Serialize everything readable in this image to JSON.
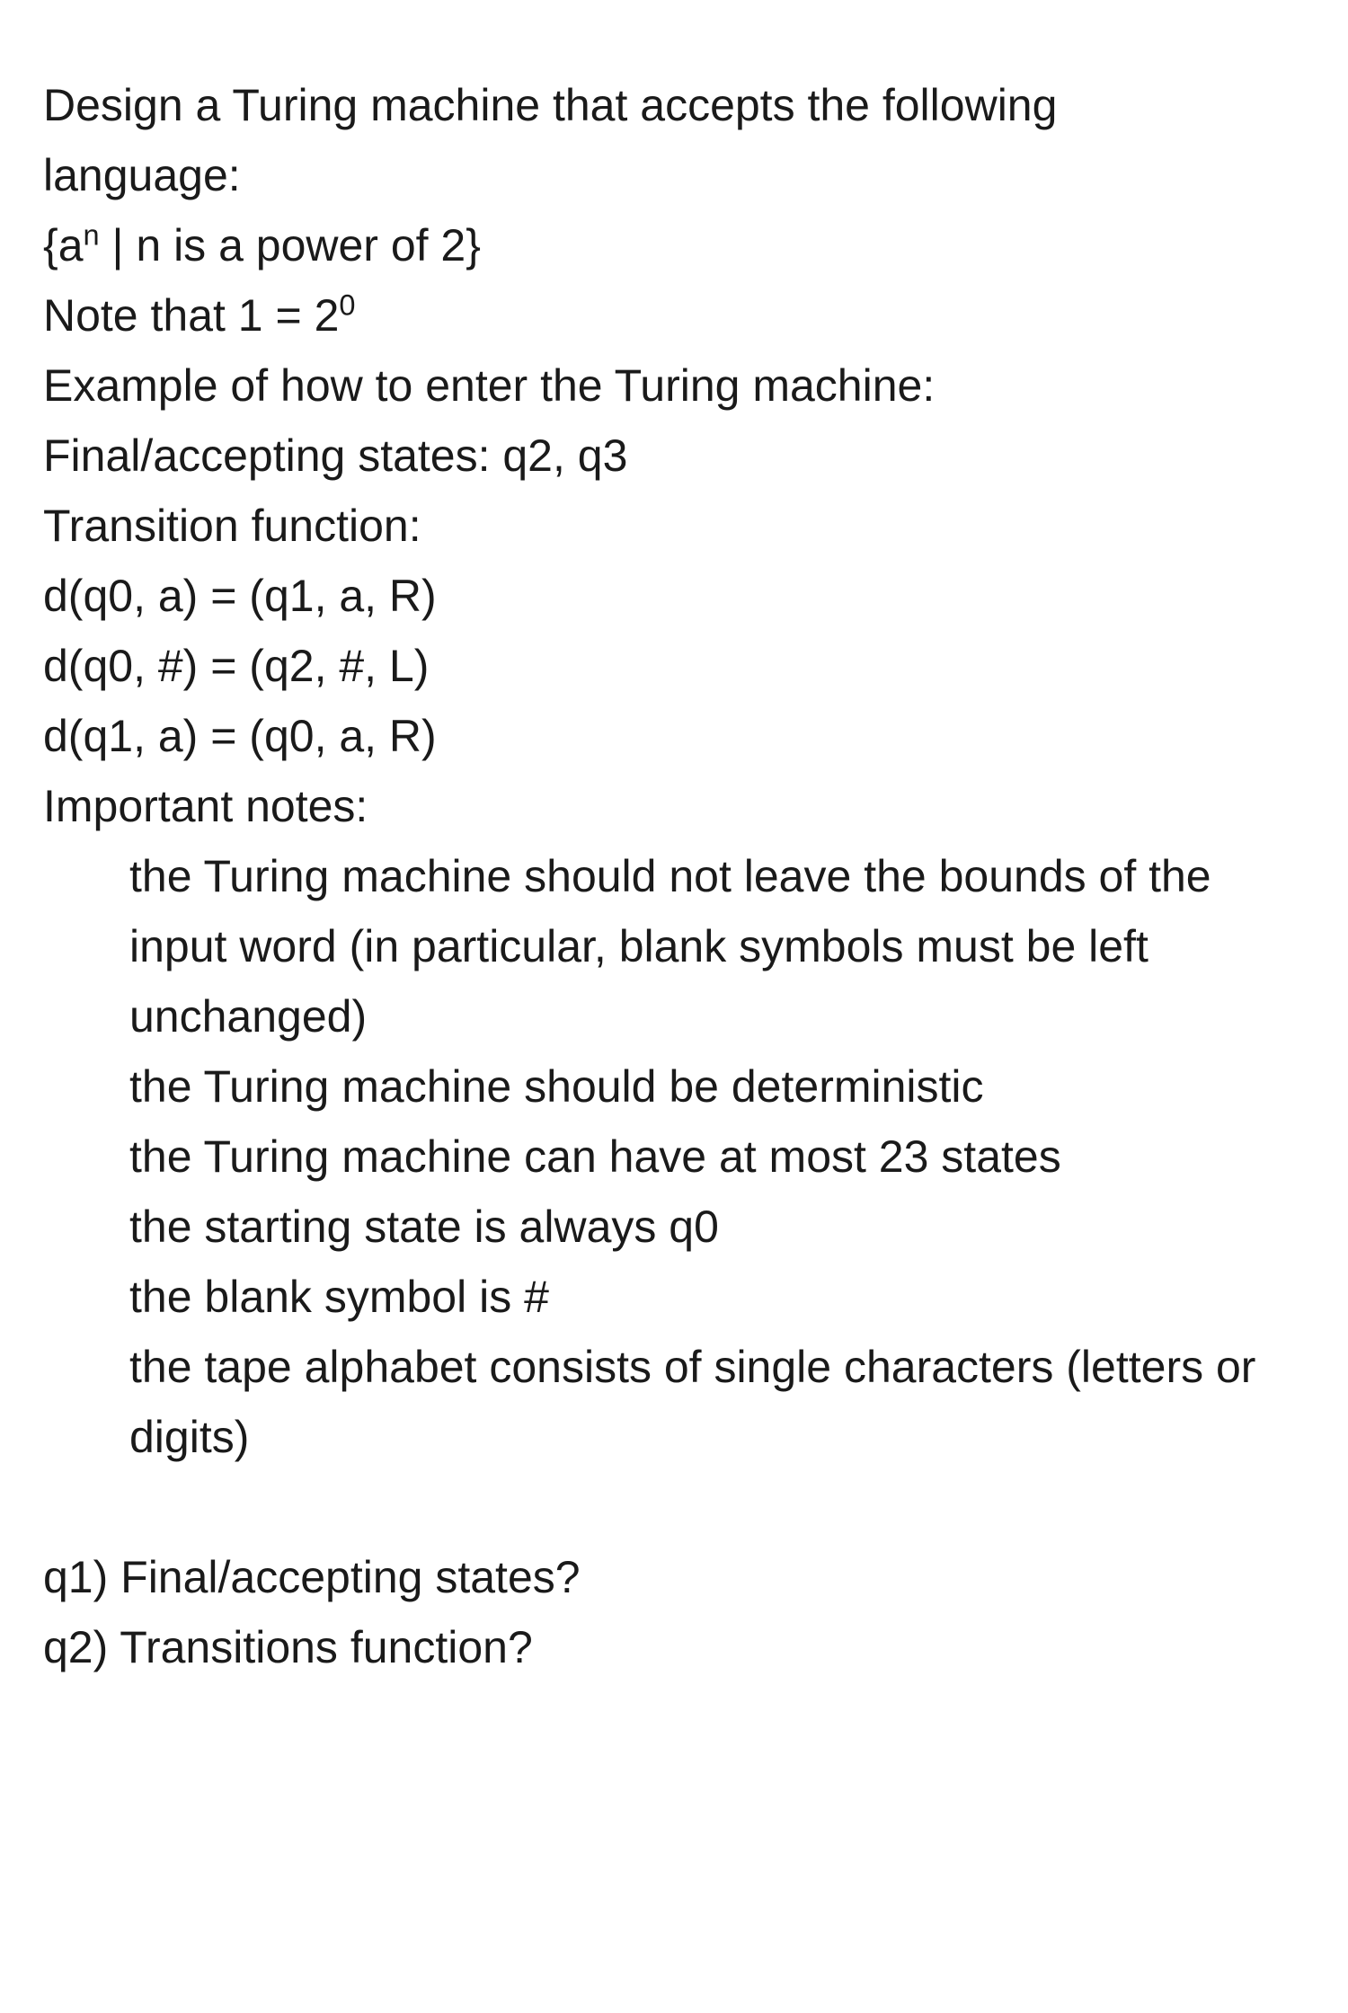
{
  "intro": {
    "line1a": "Design a Turing machine that accepts the following",
    "line1b": "language:",
    "lang_prefix": "{a",
    "lang_sup": "n",
    "lang_suffix": " | n is a power of 2}",
    "note_prefix": "Note that 1 = 2",
    "note_sup": "0",
    "example_header": "Example of how to enter the Turing machine:",
    "final_states_example": "Final/accepting states: q2, q3",
    "transition_header": "Transition function:",
    "t1": "d(q0, a) = (q1, a, R)",
    "t2": "d(q0, #) = (q2, #, L)",
    "t3": "d(q1, a) = (q0, a, R)",
    "important_notes": "Important notes:"
  },
  "bullets": [
    "the Turing machine should not leave the bounds of the input word (in particular, blank symbols must be left unchanged)",
    "the Turing machine should be deterministic",
    "the Turing machine can have at most 23 states",
    "the starting state is always q0",
    "the blank symbol is #",
    "the tape alphabet consists of single characters (letters or digits)"
  ],
  "questions": {
    "q1": "q1) Final/accepting states?",
    "q2": "q2) Transitions function?"
  }
}
